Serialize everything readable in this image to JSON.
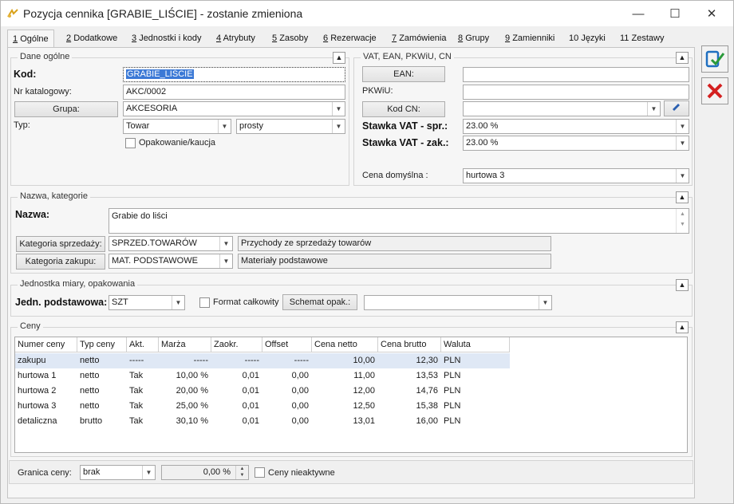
{
  "window": {
    "title": "Pozycja cennika [GRABIE_LIŚCIE] - zostanie zmieniona",
    "minimize": "—",
    "maximize": "☐",
    "close": "✕"
  },
  "tabs": [
    {
      "key": "1",
      "label": "Ogólne"
    },
    {
      "key": "2",
      "label": "Dodatkowe"
    },
    {
      "key": "3",
      "label": "Jednostki i kody"
    },
    {
      "key": "4",
      "label": "Atrybuty"
    },
    {
      "key": "5",
      "label": "Zasoby"
    },
    {
      "key": "6",
      "label": "Rezerwacje"
    },
    {
      "key": "7",
      "label": "Zamówienia"
    },
    {
      "key": "8",
      "label": "Grupy"
    },
    {
      "key": "9",
      "label": "Zamienniki"
    },
    {
      "key": "10",
      "label": "Języki"
    },
    {
      "key": "11",
      "label": "Zestawy"
    }
  ],
  "general": {
    "title": "Dane ogólne",
    "kod_label": "Kod:",
    "kod_value": "GRABIE_LIŚCIE",
    "nr_label": "Nr katalogowy:",
    "nr_value": "AKC/0002",
    "grupa_button": "Grupa:",
    "grupa_value": "AKCESORIA",
    "typ_label": "Typ:",
    "typ_value": "Towar",
    "typ2_value": "prosty",
    "opak_label": "Opakowanie/kaucja"
  },
  "vat": {
    "title": "VAT, EAN, PKWiU, CN",
    "ean_button": "EAN:",
    "ean_value": "",
    "pkwiu_label": "PKWiU:",
    "pkwiu_value": "",
    "cn_button": "Kod CN:",
    "cn_value": "",
    "spr_label": "Stawka VAT - spr.:",
    "spr_value": "23.00 %",
    "zak_label": "Stawka VAT - zak.:",
    "zak_value": "23.00 %",
    "cena_label": "Cena domyślna :",
    "cena_value": "hurtowa 3"
  },
  "naming": {
    "title": "Nazwa, kategorie",
    "nazwa_label": "Nazwa:",
    "nazwa_value": "Grabie do liści",
    "ks_button": "Kategoria sprzedaży:",
    "ks_code": "SPRZED.TOWARÓW",
    "ks_desc": "Przychody ze sprzedaży towarów",
    "kz_button": "Kategoria zakupu:",
    "kz_code": "MAT. PODSTAWOWE",
    "kz_desc": "Materiały podstawowe"
  },
  "unit": {
    "title": "Jednostka miary, opakowania",
    "label": "Jedn. podstawowa:",
    "value": "SZT",
    "format_label": "Format całkowity",
    "schemat_button": "Schemat opak.:",
    "schemat_value": ""
  },
  "prices": {
    "title": "Ceny",
    "columns": [
      "Numer ceny",
      "Typ ceny",
      "Akt.",
      "Marża",
      "Zaokr.",
      "Offset",
      "Cena netto",
      "Cena brutto",
      "Waluta"
    ],
    "rows": [
      [
        "zakupu",
        "netto",
        "-----",
        "-----",
        "-----",
        "-----",
        "10,00",
        "12,30",
        "PLN"
      ],
      [
        "hurtowa 1",
        "netto",
        "Tak",
        "10,00 %",
        "0,01",
        "0,00",
        "11,00",
        "13,53",
        "PLN"
      ],
      [
        "hurtowa 2",
        "netto",
        "Tak",
        "20,00 %",
        "0,01",
        "0,00",
        "12,00",
        "14,76",
        "PLN"
      ],
      [
        "hurtowa 3",
        "netto",
        "Tak",
        "25,00 %",
        "0,01",
        "0,00",
        "12,50",
        "15,38",
        "PLN"
      ],
      [
        "detaliczna",
        "brutto",
        "Tak",
        "30,10 %",
        "0,01",
        "0,00",
        "13,01",
        "16,00",
        "PLN"
      ]
    ]
  },
  "footer": {
    "granica_label": "Granica ceny:",
    "granica_value": "brak",
    "percent_value": "0,00 %",
    "nieaktywne_label": "Ceny nieaktywne"
  },
  "colors": {
    "accent": "#3b79d6",
    "save_icon": "#1f6fc0",
    "cancel_icon": "#d42020"
  }
}
